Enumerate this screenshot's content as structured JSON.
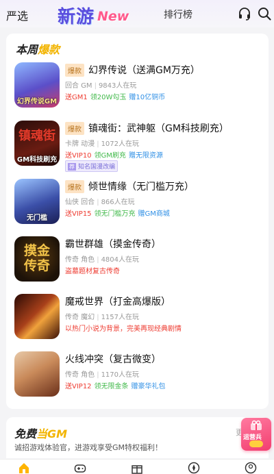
{
  "header": {
    "tab_left": "严选",
    "logo_cn": "新游",
    "logo_en": "New",
    "tab_rank": "排行榜",
    "icons": [
      "headset-icon",
      "search-icon"
    ]
  },
  "section_hot": {
    "title_a": "本周",
    "title_b": "爆款",
    "items": [
      {
        "thumb_label": "幻界传说GM",
        "thumb_big": "",
        "thumb_bg": "#5b7bd9",
        "hot_tag": "爆款",
        "name": "幻界传说（送满GM万充）",
        "meta_a": "回合 GM",
        "meta_b": "9843人在玩",
        "perks": [
          {
            "text": "送GM1",
            "color": "red"
          },
          {
            "text": "领20W勾玉",
            "color": "green"
          },
          {
            "text": "赠10亿铜币",
            "color": "blue"
          }
        ],
        "mini_tag": ""
      },
      {
        "thumb_label": "GM科技刷充",
        "thumb_big": "镇魂街",
        "thumb_bg": "#3a1a14",
        "hot_tag": "爆款",
        "name": "镇魂街：武神躯（GM科技刷充）",
        "meta_a": "卡牌 动漫",
        "meta_b": "1072人在玩",
        "perks": [
          {
            "text": "送VIP10",
            "color": "red"
          },
          {
            "text": "领GM刷充",
            "color": "green"
          },
          {
            "text": "赠无限资源",
            "color": "blue"
          }
        ],
        "mini_tag_icon": "荐",
        "mini_tag": "知名国漫改编"
      },
      {
        "thumb_label": "无门槛",
        "thumb_big": "",
        "thumb_bg": "#3b4fa8",
        "hot_tag": "爆款",
        "name": "倾世情缘（无门槛万充）",
        "meta_a": "仙侠 回合",
        "meta_b": "866人在玩",
        "perks": [
          {
            "text": "送VIP15",
            "color": "red"
          },
          {
            "text": "领无门槛万充",
            "color": "green"
          },
          {
            "text": "赠GM商城",
            "color": "blue"
          }
        ],
        "mini_tag": ""
      },
      {
        "thumb_label": "",
        "thumb_big": "摸金传奇",
        "thumb_bg": "#1d1208",
        "hot_tag": "",
        "name": "霸世群雄（摸金传奇）",
        "meta_a": "传奇 角色",
        "meta_b": "4804人在玩",
        "perks": [
          {
            "text": "盗墓题材复古传奇",
            "color": "red"
          }
        ],
        "mini_tag": ""
      },
      {
        "thumb_label": "",
        "thumb_big": "",
        "thumb_bg": "#5a1f0e",
        "hot_tag": "",
        "name": "魔戒世界（打金高爆版）",
        "meta_a": "传奇 魔幻",
        "meta_b": "1157人在玩",
        "perks": [
          {
            "text": "以热门小说为背景，完美再现经典剧情",
            "color": "red"
          }
        ],
        "mini_tag": ""
      },
      {
        "thumb_label": "",
        "thumb_big": "",
        "thumb_bg": "#c98a5a",
        "hot_tag": "",
        "name": "火线冲突（复古微变）",
        "meta_a": "传奇 角色",
        "meta_b": "1170人在玩",
        "perks": [
          {
            "text": "送VIP12",
            "color": "red"
          },
          {
            "text": "领无限金条",
            "color": "green"
          },
          {
            "text": "赠豪华礼包",
            "color": "blue"
          }
        ],
        "mini_tag": ""
      }
    ]
  },
  "section_free": {
    "title_a": "免费",
    "title_b": "当GM",
    "desc": "诚招游戏体验官，进游戏享受GM特权福利！",
    "more": "更"
  },
  "float_badge": {
    "label": "运营兵"
  },
  "tabbar": {
    "icons": [
      "home-icon",
      "gamepad-icon",
      "gift-icon",
      "compass-icon",
      "profile-icon"
    ]
  }
}
